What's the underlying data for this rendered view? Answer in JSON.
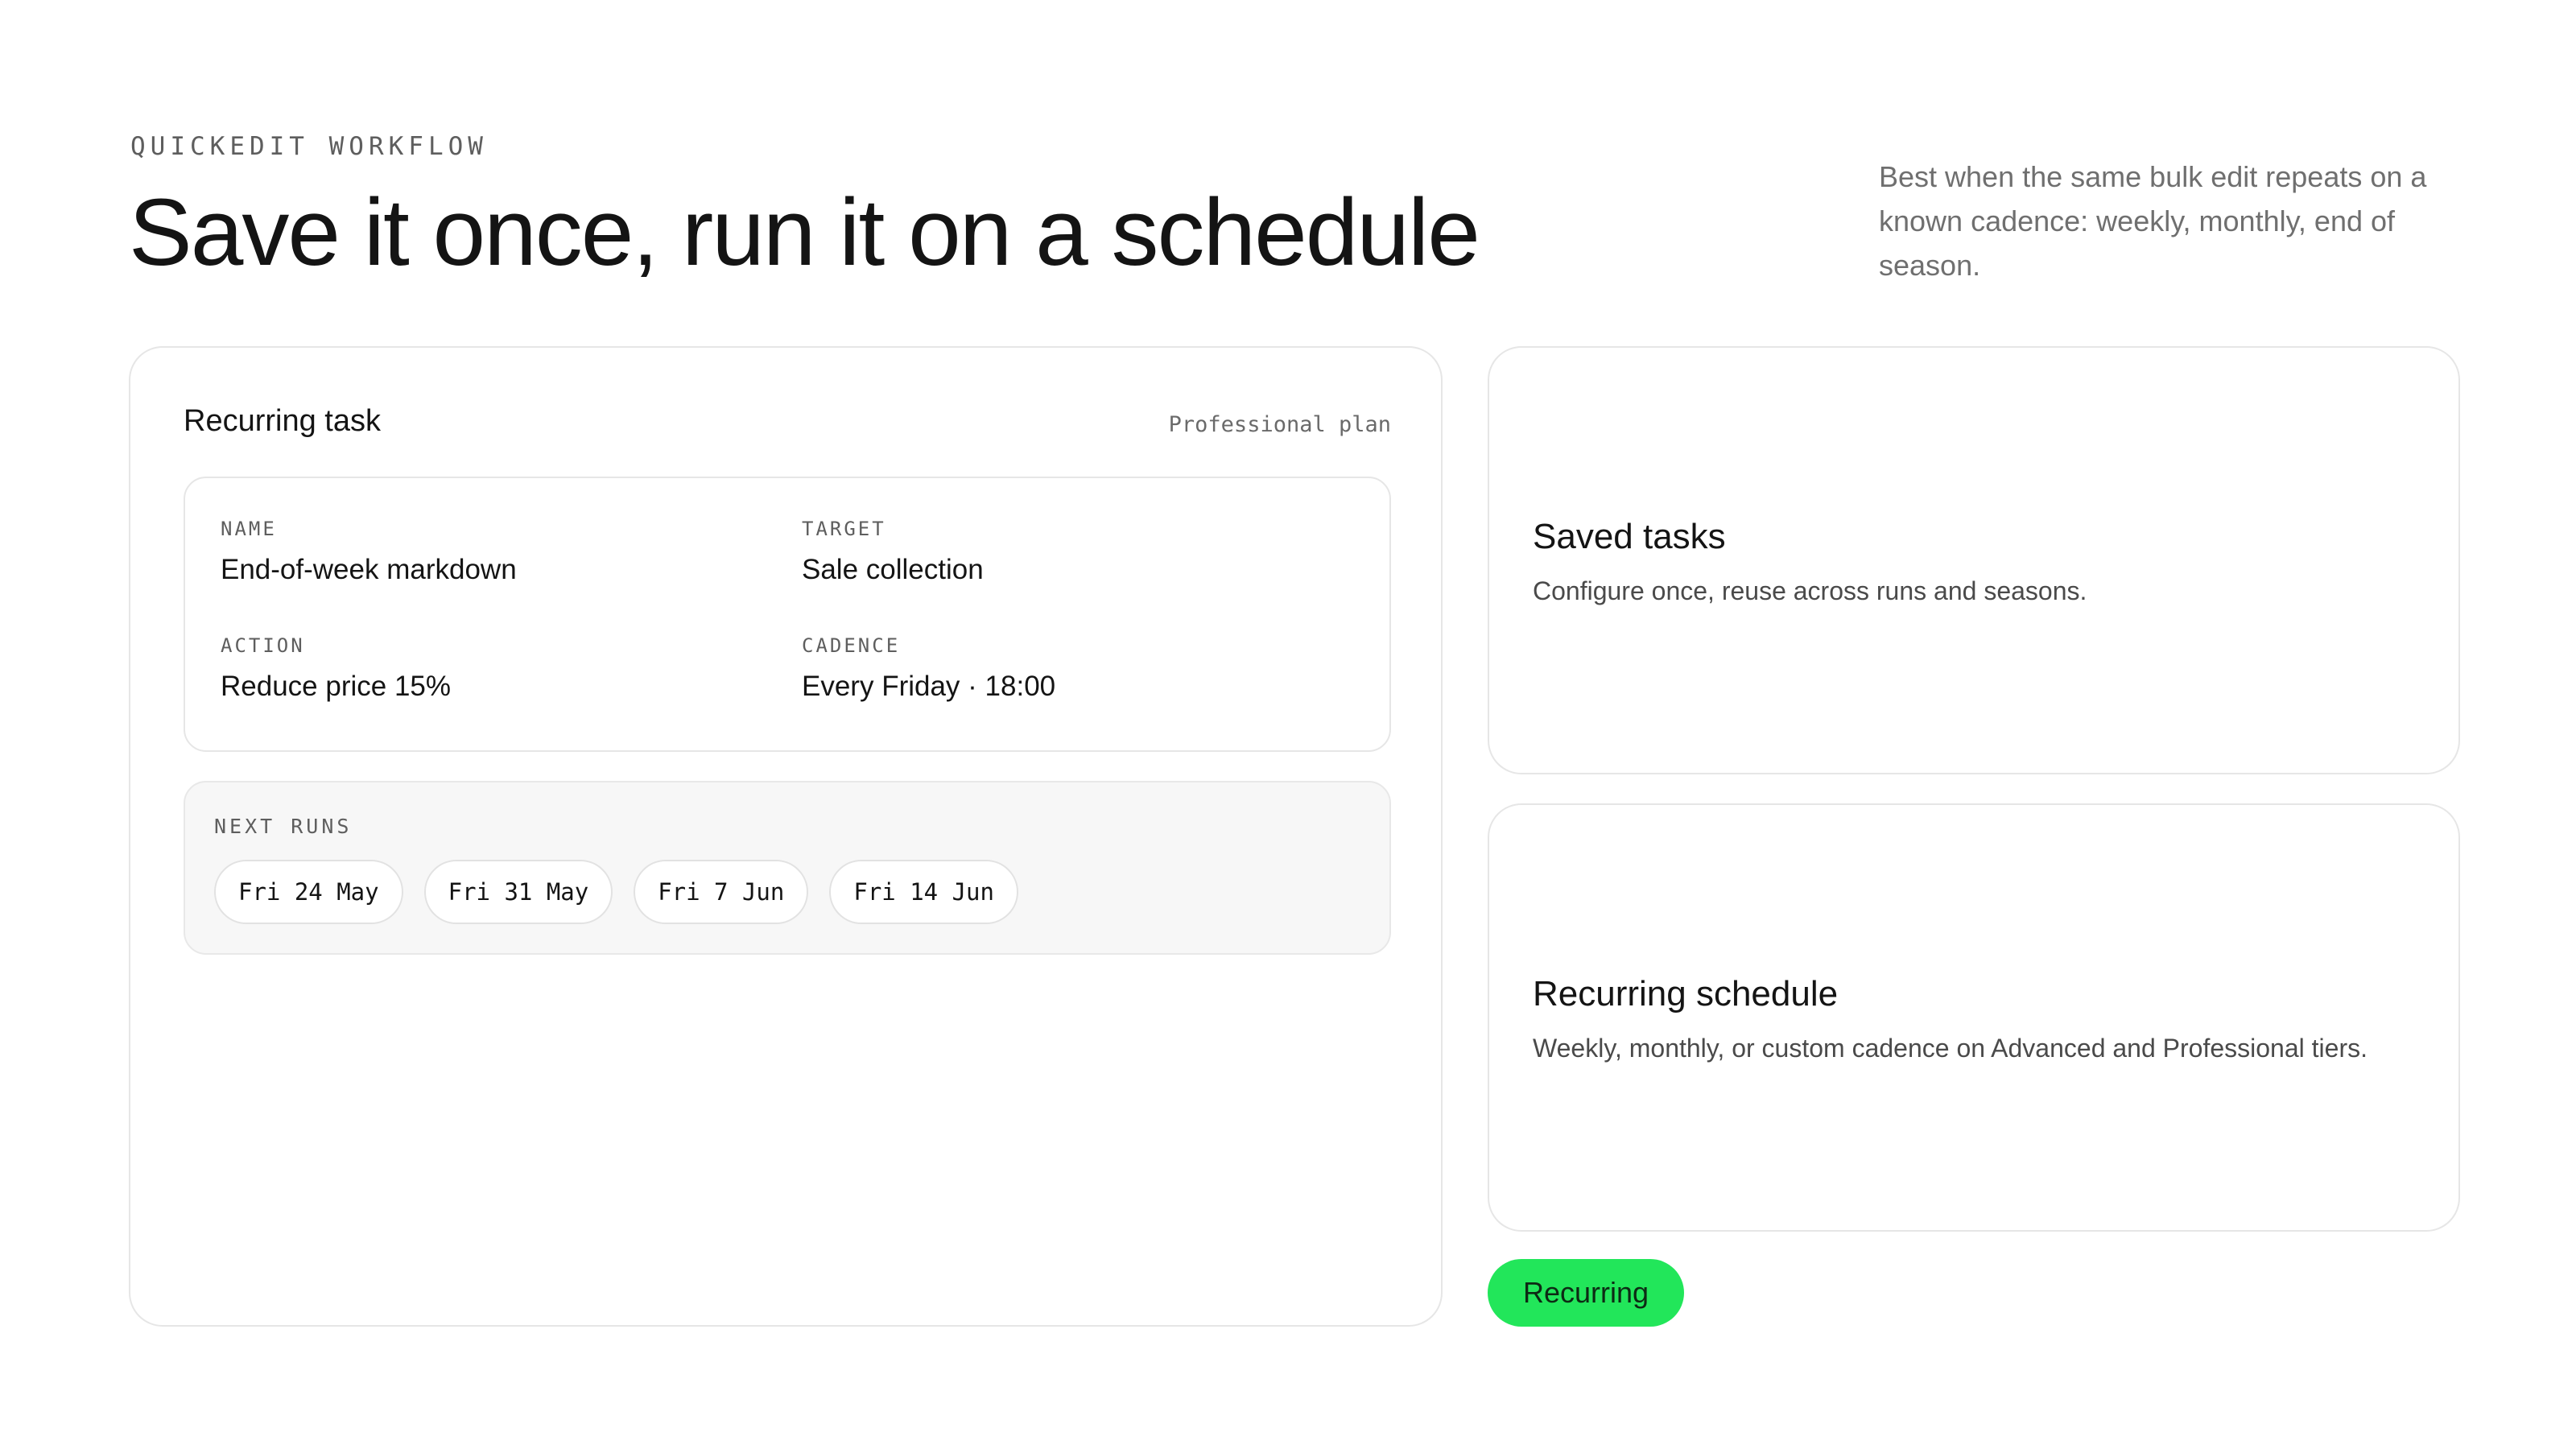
{
  "header": {
    "eyebrow": "QUICKEDIT WORKFLOW",
    "title": "Save it once, run it on a schedule",
    "intro": "Best when the same bulk edit repeats on a known cadence: weekly, monthly, end of season."
  },
  "task_panel": {
    "title": "Recurring task",
    "plan": "Professional plan",
    "fields": {
      "name": {
        "label": "NAME",
        "value": "End-of-week markdown"
      },
      "target": {
        "label": "TARGET",
        "value": "Sale collection"
      },
      "action": {
        "label": "ACTION",
        "value": "Reduce price 15%"
      },
      "cadence": {
        "label": "CADENCE",
        "value": "Every Friday · 18:00"
      }
    },
    "next_runs": {
      "label": "NEXT RUNS",
      "dates": [
        "Fri 24 May",
        "Fri 31 May",
        "Fri 7 Jun",
        "Fri 14 Jun"
      ]
    }
  },
  "features": [
    {
      "title": "Saved tasks",
      "description": "Configure once, reuse across runs and seasons."
    },
    {
      "title": "Recurring schedule",
      "description": "Weekly, monthly, or custom cadence on Advanced and Professional tiers."
    }
  ],
  "badge": {
    "label": "Recurring",
    "color": "#22e65a"
  }
}
